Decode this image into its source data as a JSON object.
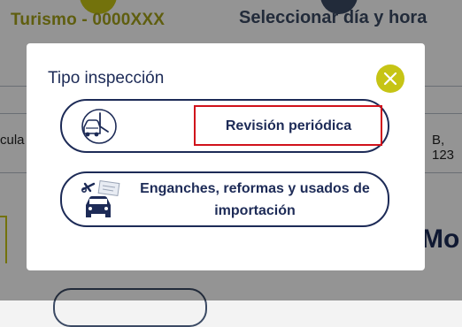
{
  "background": {
    "step1_label": "Turismo - 0000XXX",
    "step2_label": "Seleccionar día y hora",
    "left_cut_text": "cula",
    "right_cut_text": "B, 123",
    "bottom_right_text": "Mo"
  },
  "modal": {
    "title": "Tipo inspección",
    "close_icon": "close-icon",
    "options": [
      {
        "label": "Revisión periódica",
        "icon": "car-inspection-icon",
        "highlighted": true
      },
      {
        "label": "Enganches, reformas y usados de importación",
        "icon": "car-repair-tools-icon",
        "highlighted": false
      }
    ]
  },
  "colors": {
    "navy": "#1d2b57",
    "accent_yellow": "#c6c415",
    "highlight_red": "#d0121b"
  }
}
